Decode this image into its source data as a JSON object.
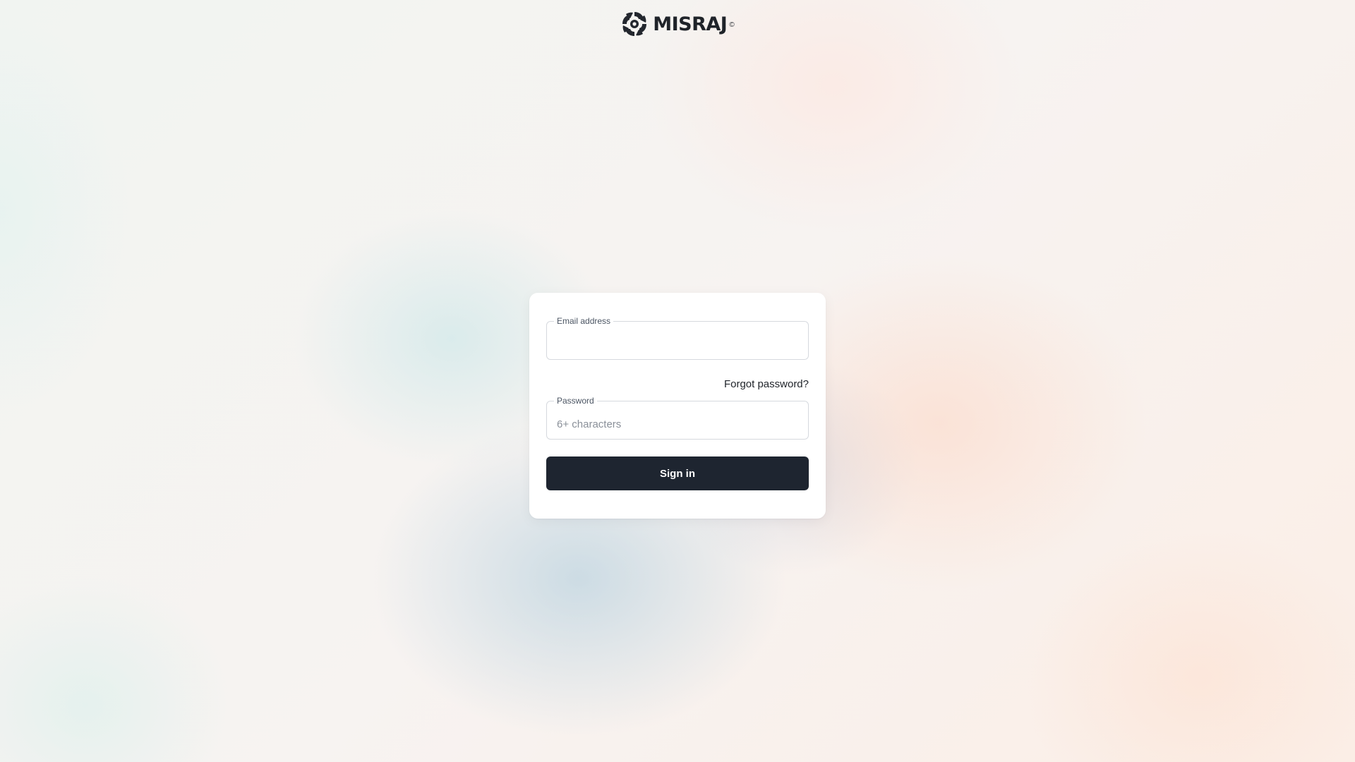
{
  "brand": {
    "name": "MISRAJ",
    "registered_mark": "©",
    "logo_icon": "pinwheel-logo-icon"
  },
  "login_form": {
    "email": {
      "label": "Email address",
      "value": "",
      "placeholder": ""
    },
    "forgot_password_label": "Forgot password?",
    "password": {
      "label": "Password",
      "value": "",
      "placeholder": "6+ characters"
    },
    "submit_label": "Sign in"
  },
  "colors": {
    "primary_button": "#1e2530",
    "card_background": "#ffffff",
    "text": "#1f2329"
  }
}
